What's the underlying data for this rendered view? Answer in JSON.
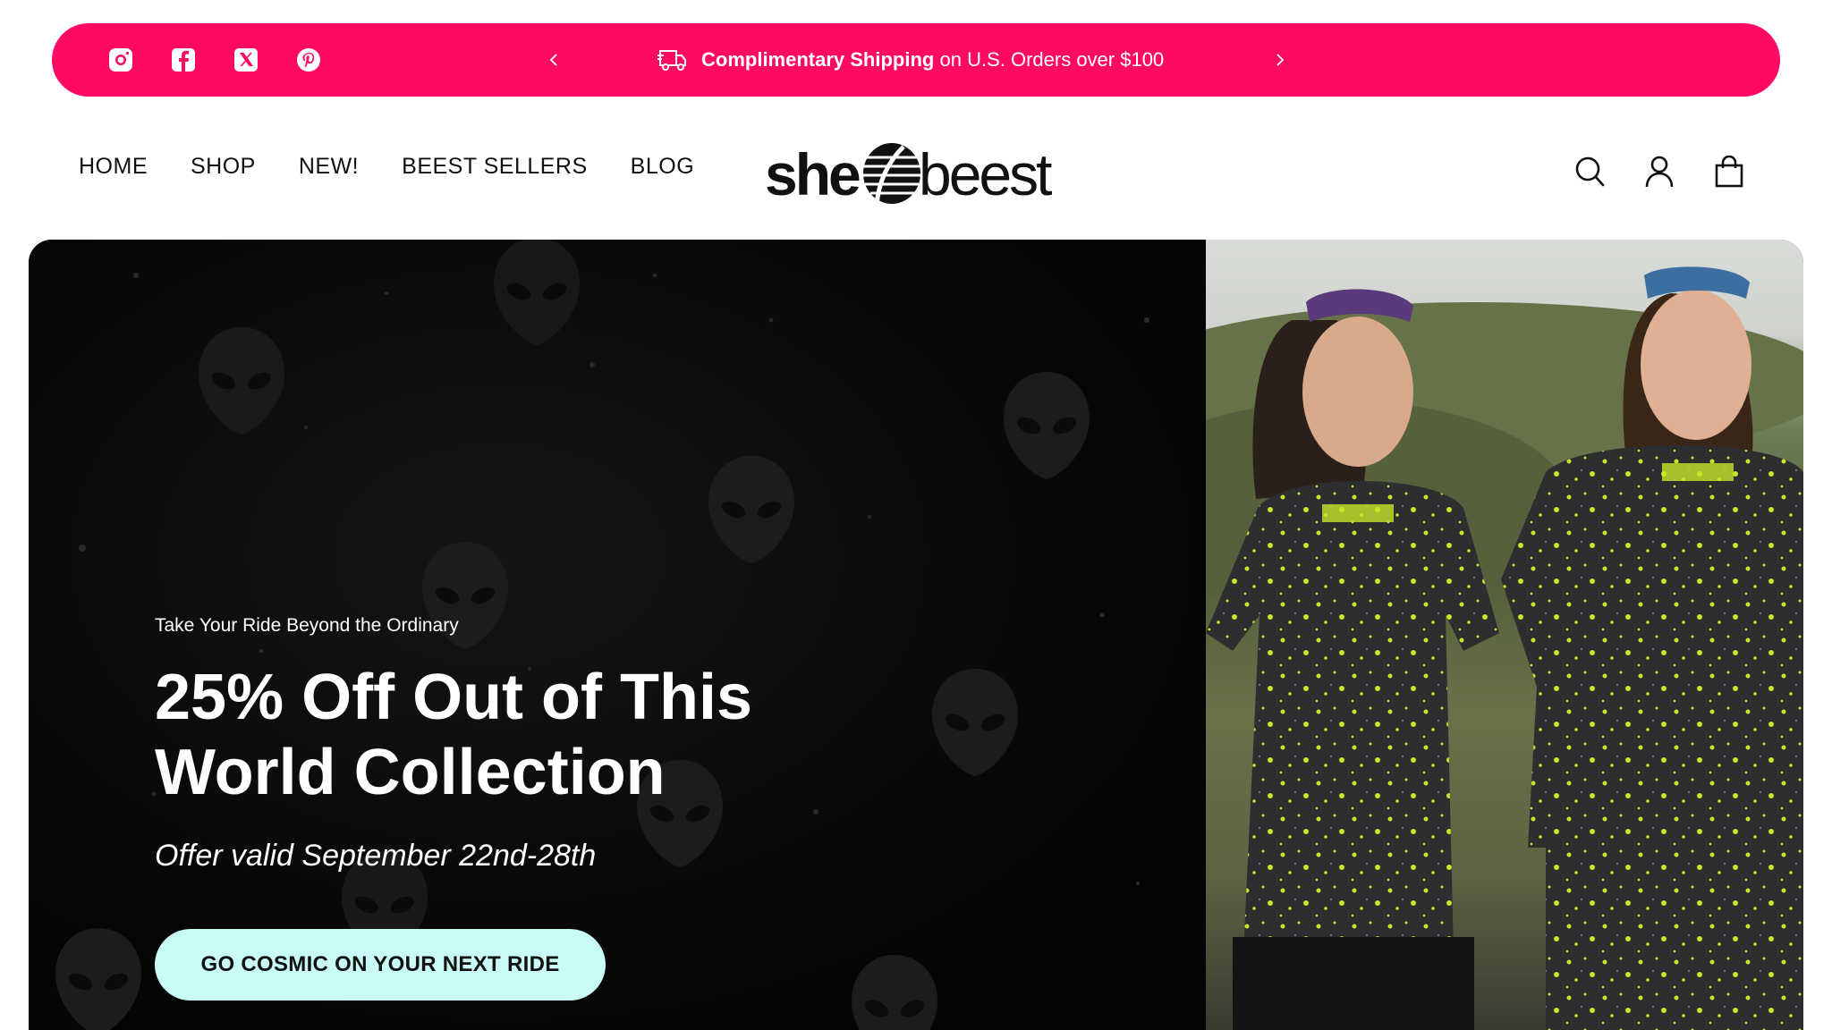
{
  "colors": {
    "announce_bg": "#ff0a62",
    "cta_bg": "#c9fbf6",
    "hero_bg": "#050505",
    "jersey_accent": "#c8e62a"
  },
  "announcement": {
    "social": [
      "instagram-icon",
      "facebook-icon",
      "x-twitter-icon",
      "pinterest-icon"
    ],
    "shipping_bold": "Complimentary Shipping",
    "shipping_rest": "on U.S. Orders over $100"
  },
  "nav": {
    "items": [
      "HOME",
      "SHOP",
      "NEW!",
      "BEEST SELLERS",
      "BLOG"
    ]
  },
  "brand": {
    "logo_text": "she beest"
  },
  "header_icons": [
    "search-icon",
    "account-icon",
    "cart-icon"
  ],
  "hero": {
    "eyebrow": "Take Your Ride Beyond the Ordinary",
    "headline": "25% Off Out of This World Collection",
    "offer": "Offer valid September 22nd-28th",
    "cta": "GO COSMIC ON YOUR NEXT RIDE"
  }
}
